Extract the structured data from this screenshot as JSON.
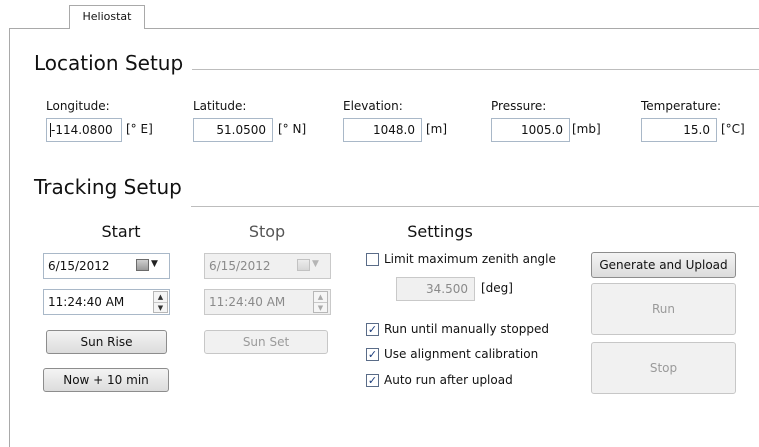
{
  "tab": {
    "label": "Heliostat"
  },
  "location": {
    "title": "Location Setup",
    "longitude": {
      "label": "Longitude:",
      "value": "-114.0800",
      "unit": "[° E]"
    },
    "latitude": {
      "label": "Latitude:",
      "value": "51.0500",
      "unit": "[° N]"
    },
    "elevation": {
      "label": "Elevation:",
      "value": "1048.0",
      "unit": "[m]"
    },
    "pressure": {
      "label": "Pressure:",
      "value": "1005.0",
      "unit": "[mb]"
    },
    "temperature": {
      "label": "Temperature:",
      "value": "15.0",
      "unit": "[°C]"
    }
  },
  "tracking": {
    "title": "Tracking Setup",
    "start": {
      "heading": "Start",
      "date": "6/15/2012",
      "time": "11:24:40 AM",
      "sunrise_label": "Sun Rise",
      "now_label": "Now + 10 min"
    },
    "stop": {
      "heading": "Stop",
      "date": "6/15/2012",
      "time": "11:24:40 AM",
      "sunset_label": "Sun Set"
    },
    "settings": {
      "heading": "Settings",
      "limit_zenith": {
        "label": "Limit maximum zenith angle",
        "checked": false
      },
      "zenith_value": "34.500",
      "zenith_unit": "[deg]",
      "run_until_stopped": {
        "label": "Run until manually stopped",
        "checked": true
      },
      "use_alignment": {
        "label": "Use alignment calibration",
        "checked": true
      },
      "auto_run": {
        "label": "Auto run after upload",
        "checked": true
      }
    },
    "actions": {
      "generate_label": "Generate and Upload",
      "run_label": "Run",
      "stop_label": "Stop"
    }
  },
  "check_glyph": "✓"
}
